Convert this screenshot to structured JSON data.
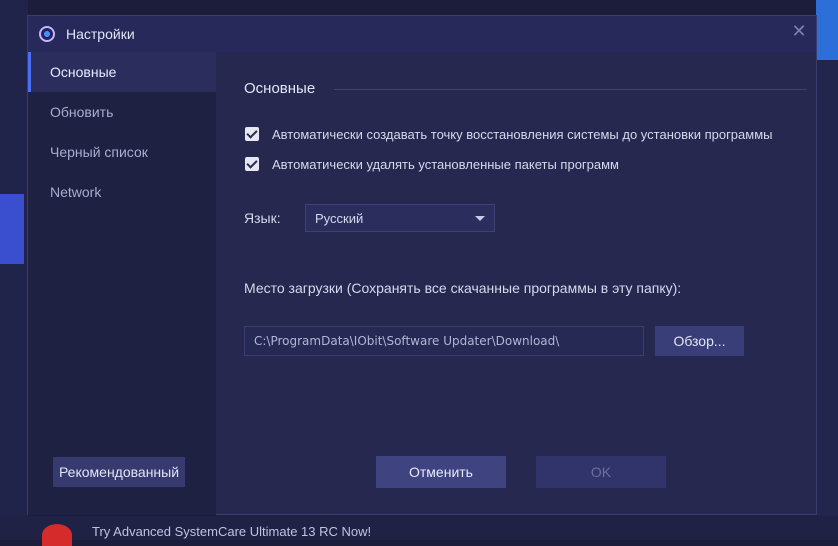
{
  "window": {
    "title": "Настройки"
  },
  "sidebar": {
    "items": [
      {
        "label": "Основные"
      },
      {
        "label": "Обновить"
      },
      {
        "label": "Черный список"
      },
      {
        "label": "Network"
      }
    ],
    "recommended_label": "Рекомендованный"
  },
  "main": {
    "section_title": "Основные",
    "checkboxes": [
      {
        "label": "Автоматически создавать точку восстановления системы до установки программы",
        "checked": true
      },
      {
        "label": "Автоматически удалять установленные пакеты программ",
        "checked": true
      }
    ],
    "language": {
      "label": "Язык:",
      "value": "Русский"
    },
    "download": {
      "label": "Место загрузки (Сохранять все скачанные программы в эту папку):",
      "path": "C:\\ProgramData\\IObit\\Software Updater\\Download\\",
      "browse_label": "Обзор..."
    }
  },
  "footer": {
    "cancel_label": "Отменить",
    "ok_label": "OK"
  },
  "background": {
    "promo_text": "Try Advanced SystemCare Ultimate 13 RC Now!"
  },
  "colors": {
    "accent": "#4c6ef5",
    "dialog_bg": "#26284f",
    "sidebar_bg": "#1f2143"
  }
}
